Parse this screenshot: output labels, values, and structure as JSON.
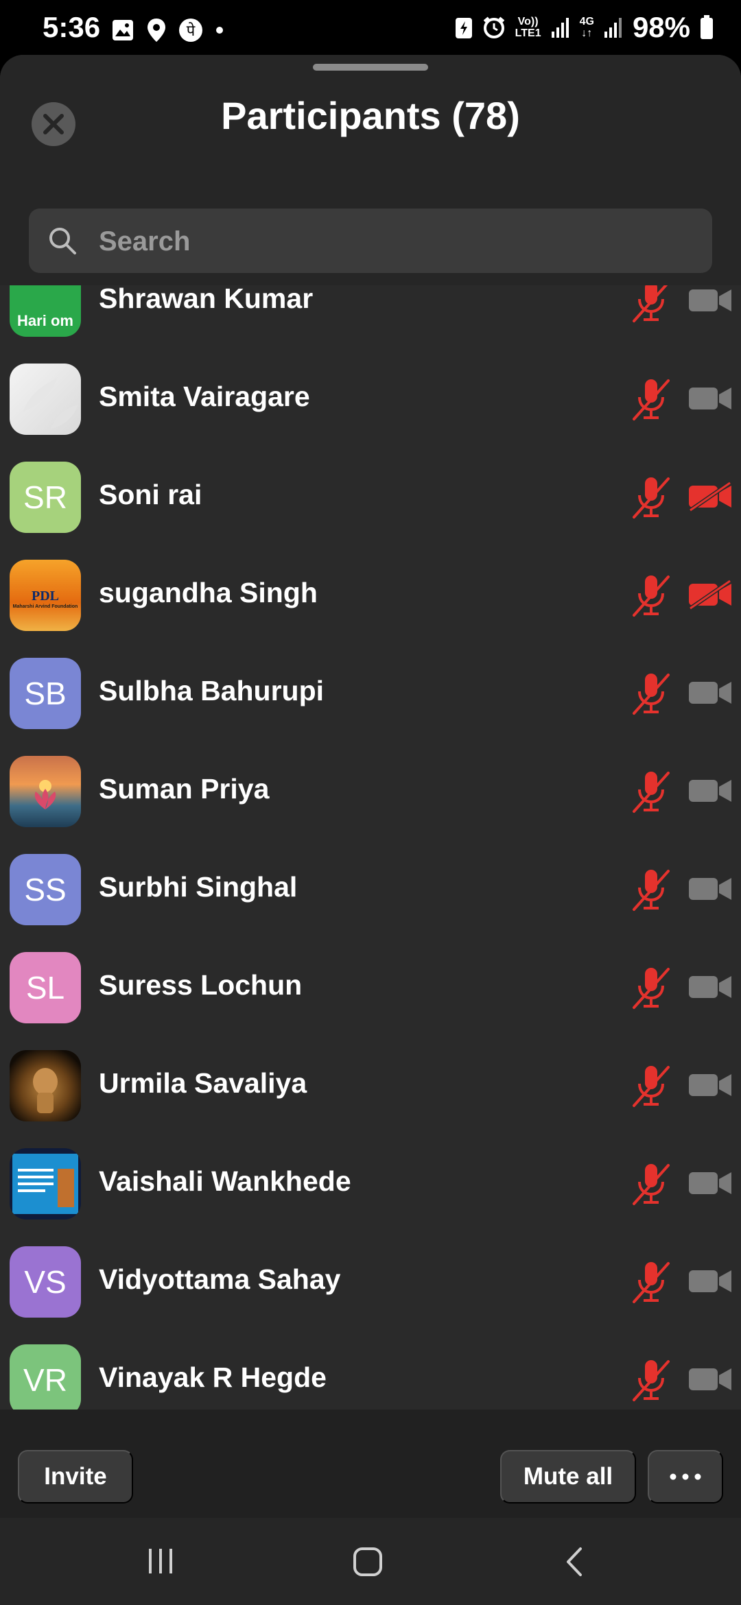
{
  "status_bar": {
    "time": "5:36",
    "battery": "98%",
    "network_top": "Vo))",
    "network_bottom": "LTE1",
    "gen": "4G"
  },
  "header": {
    "title": "Participants (78)"
  },
  "search": {
    "placeholder": "Search"
  },
  "participants": [
    {
      "name": "Shrawan Kumar",
      "avatar_text": "Hari om",
      "avatar_type": "image",
      "mic": "muted",
      "video": "off-gray"
    },
    {
      "name": "Smita Vairagare",
      "avatar_text": "",
      "avatar_type": "image",
      "mic": "muted",
      "video": "off-gray"
    },
    {
      "name": "Soni rai",
      "avatar_text": "SR",
      "avatar_color": "#a6d27c",
      "mic": "muted",
      "video": "off-red"
    },
    {
      "name": "sugandha Singh",
      "avatar_text": "PDL",
      "avatar_sub": "Maharshi Arvind Foundation",
      "avatar_type": "image",
      "mic": "muted",
      "video": "off-red"
    },
    {
      "name": "Sulbha Bahurupi",
      "avatar_text": "SB",
      "avatar_color": "#7a86d4",
      "mic": "muted",
      "video": "off-gray"
    },
    {
      "name": "Suman Priya",
      "avatar_text": "",
      "avatar_type": "image",
      "mic": "muted",
      "video": "off-gray"
    },
    {
      "name": "Surbhi Singhal",
      "avatar_text": "SS",
      "avatar_color": "#7a86d4",
      "mic": "muted",
      "video": "off-gray"
    },
    {
      "name": "Suress Lochun",
      "avatar_text": "SL",
      "avatar_color": "#e287c0",
      "mic": "muted",
      "video": "off-gray"
    },
    {
      "name": "Urmila Savaliya",
      "avatar_text": "",
      "avatar_type": "image",
      "mic": "muted",
      "video": "off-gray"
    },
    {
      "name": "Vaishali Wankhede",
      "avatar_text": "",
      "avatar_type": "image",
      "mic": "muted",
      "video": "off-gray"
    },
    {
      "name": "Vidyottama Sahay",
      "avatar_text": "VS",
      "avatar_color": "#9a73d2",
      "mic": "muted",
      "video": "off-gray"
    },
    {
      "name": "Vinayak R Hegde",
      "avatar_text": "VR",
      "avatar_color": "#7cc47c",
      "mic": "muted",
      "video": "off-gray"
    }
  ],
  "footer": {
    "invite_label": "Invite",
    "mute_all_label": "Mute all",
    "more_label": "•••"
  },
  "colors": {
    "muted_red": "#e5322d",
    "video_gray": "#7a7a7a",
    "background": "#2a2a2a"
  }
}
